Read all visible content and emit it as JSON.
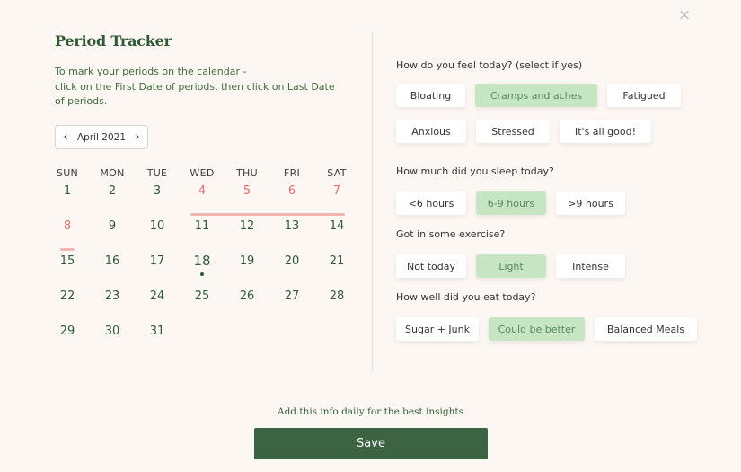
{
  "header": {
    "title": "Period Tracker",
    "close_icon": "×",
    "instructions": [
      "To mark your periods on the calendar -",
      "click on the First Date of periods, then click on Last Date of periods."
    ]
  },
  "calendar": {
    "month_label": "April 2021",
    "prev_icon": "‹",
    "next_icon": "›",
    "weekdays": [
      "SUN",
      "MON",
      "TUE",
      "WED",
      "THU",
      "FRI",
      "SAT"
    ],
    "weeks": [
      [
        "1",
        "2",
        "3",
        "4",
        "5",
        "6",
        "7"
      ],
      [
        "8",
        "9",
        "10",
        "11",
        "12",
        "13",
        "14"
      ],
      [
        "15",
        "16",
        "17",
        "18",
        "19",
        "20",
        "21"
      ],
      [
        "22",
        "23",
        "24",
        "25",
        "26",
        "27",
        "28"
      ],
      [
        "29",
        "30",
        "31",
        "",
        "",
        "",
        ""
      ]
    ],
    "period_days": [
      "4",
      "5",
      "6",
      "7",
      "8"
    ],
    "today": "18"
  },
  "questions": [
    {
      "label": "How do you feel today? (select if yes)",
      "rows": [
        [
          {
            "label": "Bloating",
            "selected": false
          },
          {
            "label": "Cramps and aches",
            "selected": true
          },
          {
            "label": "Fatigued",
            "selected": false
          }
        ],
        [
          {
            "label": "Anxious",
            "selected": false
          },
          {
            "label": "Stressed",
            "selected": false
          },
          {
            "label": "It's all good!",
            "selected": false
          }
        ]
      ]
    },
    {
      "label": "How much did you sleep today?",
      "rows": [
        [
          {
            "label": "<6 hours",
            "selected": false
          },
          {
            "label": "6-9 hours",
            "selected": true
          },
          {
            "label": ">9 hours",
            "selected": false
          }
        ]
      ]
    },
    {
      "label": "Got in some exercise?",
      "rows": [
        [
          {
            "label": "Not today",
            "selected": false
          },
          {
            "label": "Light",
            "selected": true
          },
          {
            "label": "Intense",
            "selected": false
          }
        ]
      ]
    },
    {
      "label": "How well did you eat today?",
      "rows": [
        [
          {
            "label": "Sugar + Junk",
            "selected": false
          },
          {
            "label": "Could be better",
            "selected": true
          },
          {
            "label": "Balanced Meals",
            "selected": false
          }
        ]
      ]
    }
  ],
  "footer": {
    "note": "Add this info daily for the best insights",
    "save_label": "Save"
  },
  "colors": {
    "background": "#fdf7f3",
    "primary": "#3c6342",
    "period": "#e06e6e",
    "period_bar": "#f2b4b1",
    "selected_chip": "#c6e5c3"
  }
}
